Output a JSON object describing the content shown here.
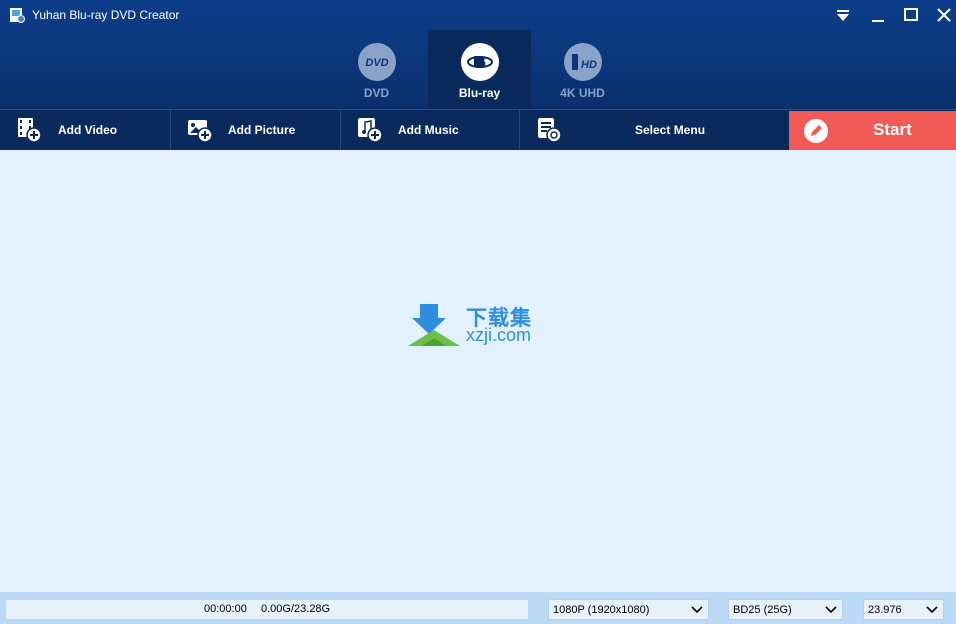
{
  "window": {
    "title": "Yuhan Blu-ray DVD Creator"
  },
  "modes": [
    {
      "label": "DVD",
      "icon": "dvd-logo-icon",
      "active": false
    },
    {
      "label": "Blu-ray",
      "icon": "bluray-logo-icon",
      "active": true
    },
    {
      "label": "4K UHD",
      "icon": "4k-uhd-logo-icon",
      "active": false
    }
  ],
  "toolbar": {
    "add_video": "Add Video",
    "add_picture": "Add Picture",
    "add_music": "Add Music",
    "select_menu": "Select Menu",
    "start": "Start"
  },
  "watermark": {
    "cn": "下载集",
    "en": "xzji.com"
  },
  "status": {
    "time": "00:00:00",
    "size": "0.00G/23.28G",
    "progress": 0,
    "resolution": "1080P (1920x1080)",
    "disc_type": "BD25 (25G)",
    "frame_rate": "23.976"
  },
  "colors": {
    "title_bg": "#0d3e8a",
    "toolbar_bg": "#0a2a5d",
    "start_bg": "#f25a55",
    "content_bg": "#e3f0fd",
    "status_bg": "#bcd9f6"
  }
}
